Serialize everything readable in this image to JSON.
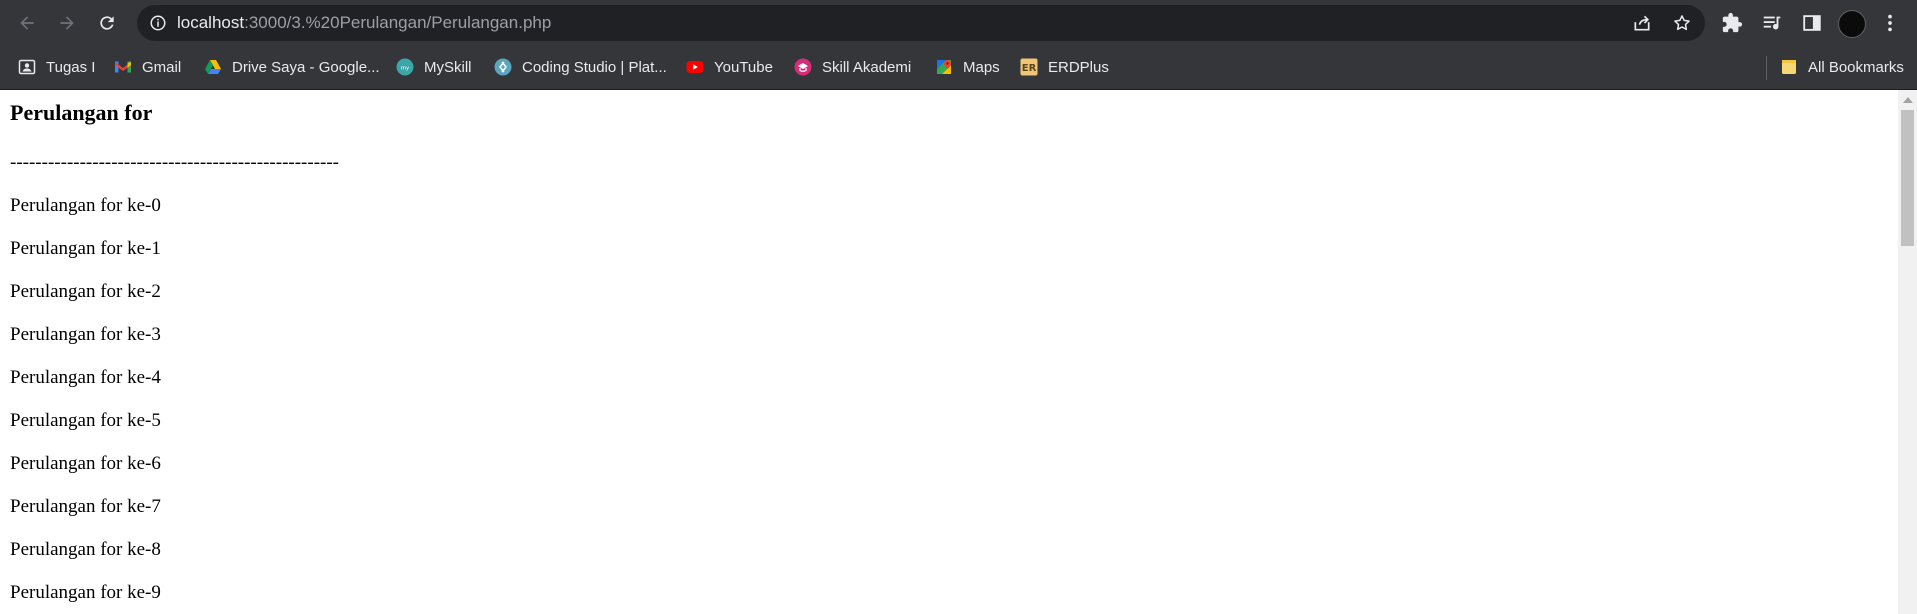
{
  "browser": {
    "url_host": "localhost",
    "url_path": ":3000/3.%20Perulangan/Perulangan.php",
    "bookmarks": [
      {
        "label": "Tugas I",
        "icon": "contact-card-icon"
      },
      {
        "label": "Gmail",
        "icon": "gmail-icon"
      },
      {
        "label": "Drive Saya - Google...",
        "icon": "google-drive-icon"
      },
      {
        "label": "MySkill",
        "icon": "myskill-icon"
      },
      {
        "label": "Coding Studio | Plat...",
        "icon": "coding-studio-icon"
      },
      {
        "label": "YouTube",
        "icon": "youtube-icon"
      },
      {
        "label": "Skill Akademi",
        "icon": "skill-akademi-icon"
      },
      {
        "label": "Maps",
        "icon": "google-maps-icon"
      },
      {
        "label": "ERDPlus",
        "icon": "erdplus-icon"
      }
    ],
    "all_bookmarks_label": "All Bookmarks",
    "erdplus_favicon_text": "ER"
  },
  "page": {
    "heading": "Perulangan for",
    "separator": "----------------------------------------------------",
    "lines": [
      "Perulangan for ke-0",
      "Perulangan for ke-1",
      "Perulangan for ke-2",
      "Perulangan for ke-3",
      "Perulangan for ke-4",
      "Perulangan for ke-5",
      "Perulangan for ke-6",
      "Perulangan for ke-7",
      "Perulangan for ke-8",
      "Perulangan for ke-9"
    ]
  },
  "colors": {
    "chrome_bg": "#35363a",
    "omnibox_bg": "#202124",
    "icon": "#e8eaed",
    "page_bg": "#ffffff"
  }
}
